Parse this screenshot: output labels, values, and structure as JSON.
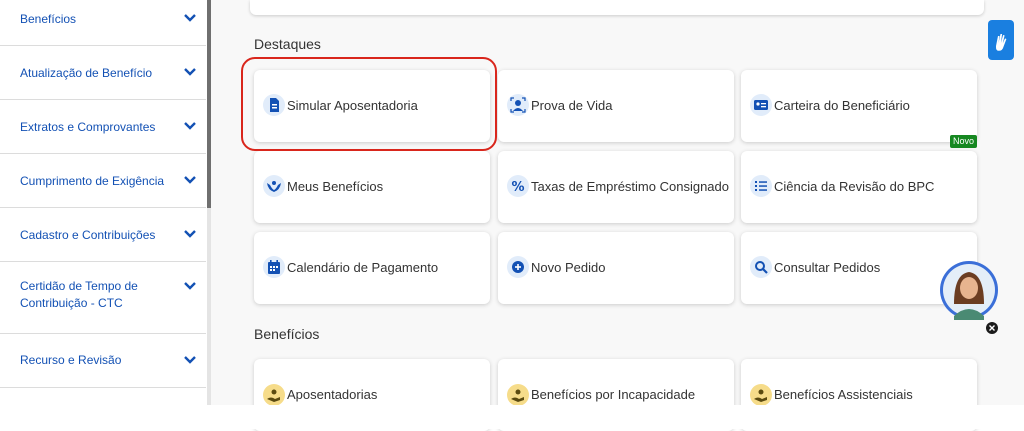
{
  "sidebar": {
    "items": [
      {
        "label": "Benefícios"
      },
      {
        "label": "Atualização de Benefício"
      },
      {
        "label": "Extratos e Comprovantes"
      },
      {
        "label": "Cumprimento de Exigência"
      },
      {
        "label": "Cadastro e Contribuições"
      },
      {
        "label": "Certidão de Tempo de Contribuição - CTC"
      },
      {
        "label": "Recurso e Revisão"
      }
    ]
  },
  "destaques": {
    "title": "Destaques",
    "cards": [
      {
        "label": "Simular Aposentadoria",
        "icon": "document-icon"
      },
      {
        "label": "Prova de Vida",
        "icon": "person-scan-icon"
      },
      {
        "label": "Carteira do Beneficiário",
        "icon": "id-card-icon"
      },
      {
        "label": "Meus Benefícios",
        "icon": "hands-icon"
      },
      {
        "label": "Taxas de Empréstimo Consignado",
        "icon": "percent-icon"
      },
      {
        "label": "Ciência da Revisão do BPC",
        "icon": "checklist-icon",
        "badge": "Novo"
      },
      {
        "label": "Calendário de Pagamento",
        "icon": "calendar-icon"
      },
      {
        "label": "Novo Pedido",
        "icon": "plus-circle-icon"
      },
      {
        "label": "Consultar Pedidos",
        "icon": "search-icon"
      }
    ]
  },
  "beneficios": {
    "title": "Benefícios",
    "cards": [
      {
        "label": "Aposentadorias",
        "icon": "hand-coin-icon"
      },
      {
        "label": "Benefícios por Incapacidade",
        "icon": "hand-coin-icon"
      },
      {
        "label": "Benefícios Assistenciais",
        "icon": "hand-coin-icon"
      }
    ]
  },
  "colors": {
    "accent": "#1351b4",
    "highlight": "#d9261c",
    "badge": "#168821"
  }
}
